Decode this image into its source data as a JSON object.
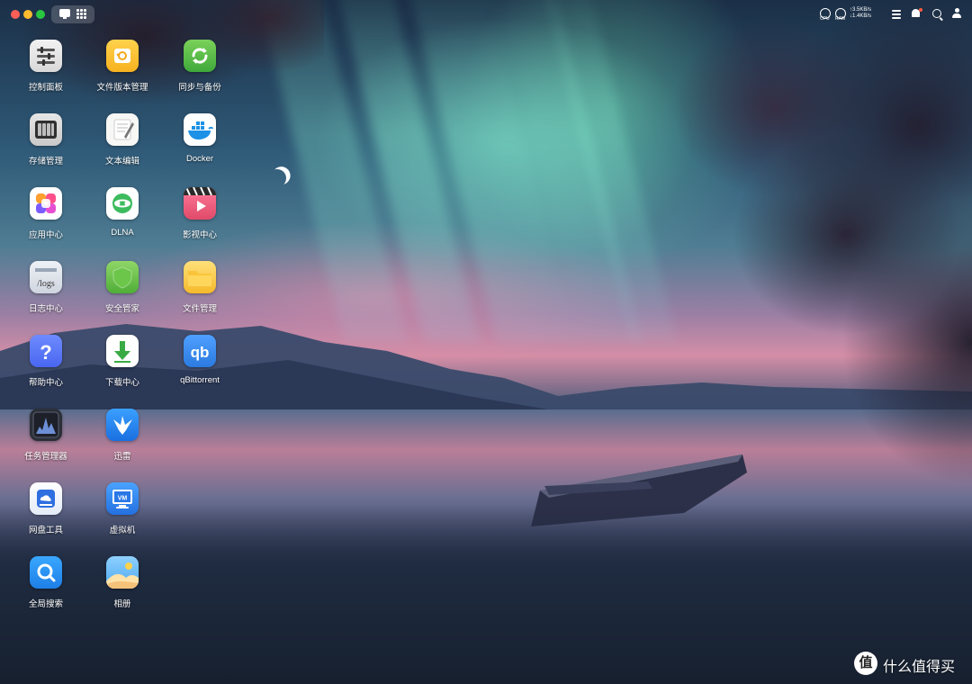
{
  "topbar": {
    "cpu_label": "CPU",
    "ram_label": "RAM",
    "upload_speed": "3.5KB/s",
    "download_speed": "1.4KB/s"
  },
  "apps": [
    {
      "label": "控制面板",
      "icon": "control-panel-icon"
    },
    {
      "label": "文件版本管理",
      "icon": "file-version-icon"
    },
    {
      "label": "同步与备份",
      "icon": "sync-backup-icon"
    },
    {
      "label": "存储管理",
      "icon": "storage-icon"
    },
    {
      "label": "文本编辑",
      "icon": "text-editor-icon"
    },
    {
      "label": "Docker",
      "icon": "docker-icon"
    },
    {
      "label": "应用中心",
      "icon": "app-center-icon"
    },
    {
      "label": "DLNA",
      "icon": "dlna-icon"
    },
    {
      "label": "影视中心",
      "icon": "video-center-icon"
    },
    {
      "label": "日志中心",
      "icon": "log-center-icon",
      "glyph_text": "/logs"
    },
    {
      "label": "安全管家",
      "icon": "security-shield-icon"
    },
    {
      "label": "文件管理",
      "icon": "folder-icon"
    },
    {
      "label": "帮助中心",
      "icon": "help-icon",
      "glyph_text": "?"
    },
    {
      "label": "下载中心",
      "icon": "download-icon"
    },
    {
      "label": "qBittorrent",
      "icon": "qbittorrent-icon",
      "glyph_text": "qb"
    },
    {
      "label": "任务管理器",
      "icon": "task-manager-icon"
    },
    {
      "label": "迅雷",
      "icon": "thunder-bird-icon"
    },
    {
      "label": "网盘工具",
      "icon": "cloud-drive-icon"
    },
    {
      "label": "虚拟机",
      "icon": "virtual-machine-icon",
      "glyph_text": "VM"
    },
    {
      "label": "全局搜索",
      "icon": "global-search-icon"
    },
    {
      "label": "相册",
      "icon": "photo-album-icon"
    }
  ],
  "watermark": {
    "badge": "值",
    "text": "什么值得买"
  },
  "colors": {
    "close": "#ff5f57",
    "minimize": "#febc2e",
    "maximize": "#28c840",
    "notification_dot": "#ff5a3c"
  }
}
